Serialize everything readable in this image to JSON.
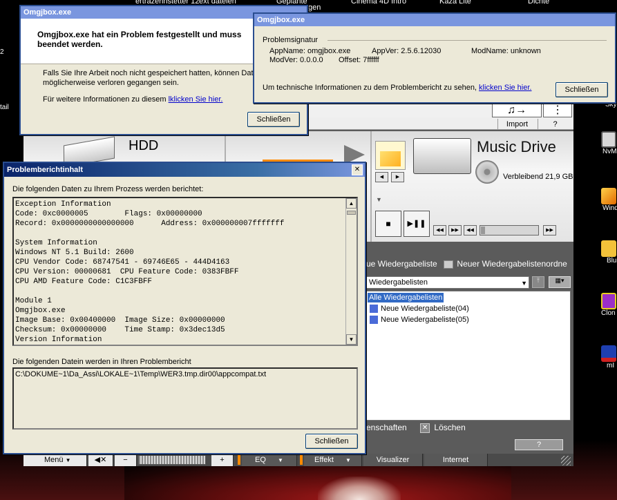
{
  "desktop": {
    "top_labels": [
      "ertrazehnstetter 12",
      "ext datelen",
      "Geplante",
      "gen",
      "Cinema 4D Intro",
      "Kaza Lite",
      "Dichte"
    ],
    "side_labels": [
      "2",
      "tail"
    ],
    "icons": [
      {
        "name": "skype-icon",
        "label": "Sky",
        "color": "#1b7fd6"
      },
      {
        "name": "nvm-icon",
        "label": "NvM",
        "color": "#e8e8e8"
      },
      {
        "name": "winamp-icon",
        "label": "Wind",
        "color": "#f0a010"
      },
      {
        "name": "blue-icon",
        "label": "Blu",
        "color": "#f3c23a"
      },
      {
        "name": "clonecd-icon",
        "label": "Clon",
        "color": "#9b2fc8"
      },
      {
        "name": "mirc-icon",
        "label": "mI",
        "color": "#1e3fb0"
      }
    ]
  },
  "player": {
    "import_label": "Import",
    "help_label": "?",
    "hdd_label": "HDD",
    "drive_title": "Music Drive",
    "drive_remaining": "Verbleibend 21,9 GB",
    "playlist_header_a": "ue Wiedergabeliste",
    "playlist_header_b": "Neuer Wiedergabelistenordne",
    "playlist_select": "Wiedergabelisten",
    "playlist_items": [
      "Alle Wiedergabelisten",
      "Neue Wiedergabeliste(04)",
      "Neue Wiedergabeliste(05)"
    ],
    "bottom_props": "enschaften",
    "bottom_delete": "Löschen",
    "bottom_help": "?",
    "footer": {
      "menu": "Menü",
      "minus": "−",
      "plus": "+",
      "eq": "EQ",
      "effekt": "Effekt",
      "visualizer": "Visualizer",
      "internet": "Internet"
    },
    "accent": "#ff8a00"
  },
  "dialog1": {
    "title": "Omgjbox.exe",
    "heading": "Omgjbox.exe hat ein Problem festgestellt und muss beendet werden.",
    "body1": "Falls Sie Ihre Arbeit noch nicht gespeichert hatten, können Daten möglicherweise verloren gegangen sein.",
    "body2_prefix": "Für weitere Informationen zu diesem ",
    "body2_link": "lklicken Sie hier.",
    "close_button": "Schließen"
  },
  "dialog2": {
    "title": "Omgjbox.exe",
    "group_label": "Problemsignatur",
    "appname": "AppName: omgjbox.exe",
    "appver": "AppVer: 2.5.6.12030",
    "modname": "ModName: unknown",
    "modver": "ModVer: 0.0.0.0",
    "offset": "Offset: 7ffffff",
    "info_prefix": "Um technische Informationen zu dem Problembericht zu sehen, ",
    "info_link": "klicken Sie hier.",
    "close_button": "Schließen"
  },
  "dialog3": {
    "title": "Problemberichtinhalt",
    "close_glyph": "✕",
    "intro": "Die folgenden Daten zu Ihrem Prozess werden berichtet:",
    "report_lines": [
      "Exception Information",
      "Code: 0xc0000005        Flags: 0x00000000",
      "Record: 0x0000000000000000      Address: 0x000000007fffffff",
      "",
      "System Information",
      "Windows NT 5.1 Build: 2600",
      "CPU Vendor Code: 68747541 - 69746E65 - 444D4163",
      "CPU Version: 00000681  CPU Feature Code: 0383FBFF",
      "CPU AMD Feature Code: C1C3FBFF",
      "",
      "Module 1",
      "Omgjbox.exe",
      "Image Base: 0x00400000  Image Size: 0x00000000",
      "Checksum: 0x00000000    Time Stamp: 0x3dec13d5",
      "Version Information"
    ],
    "files_label": "Die folgenden Datein werden in Ihren Problembericht",
    "file_path": "C:\\DOKUME~1\\Da_Assi\\LOKALE~1\\Temp\\WER3.tmp.dir00\\appcompat.txt",
    "close_button": "Schließen"
  }
}
